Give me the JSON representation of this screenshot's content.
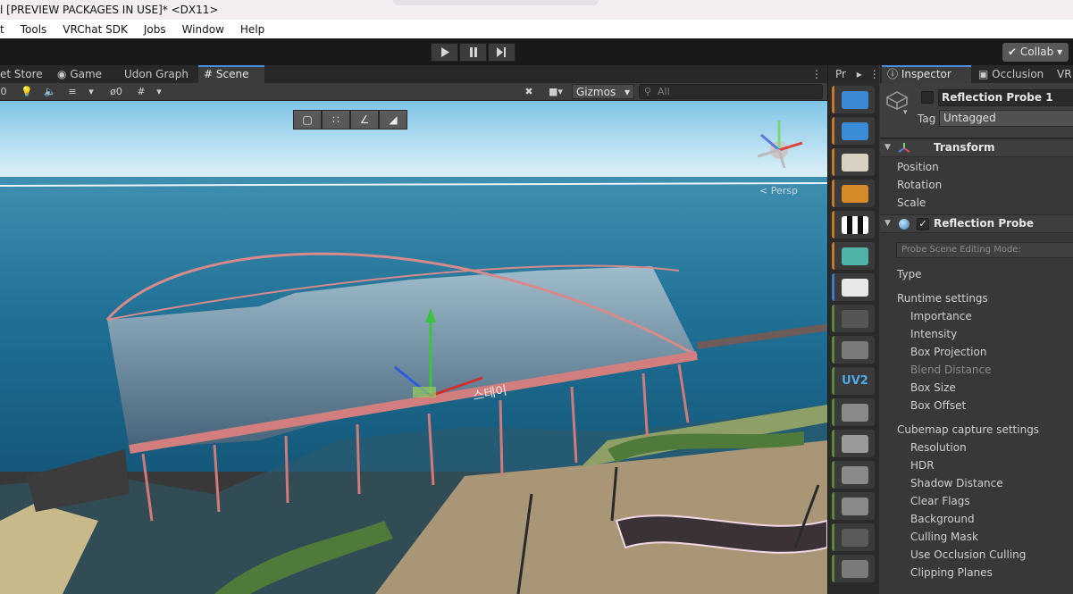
{
  "window": {
    "title": "l [PREVIEW PACKAGES IN USE]* <DX11>"
  },
  "menu": [
    "t",
    "Tools",
    "VRChat SDK",
    "Jobs",
    "Window",
    "Help"
  ],
  "toolbar": {
    "play_icon": "play-icon",
    "pause_icon": "pause-icon",
    "step_icon": "step-icon",
    "collab_label": "Collab"
  },
  "scene_tabs": [
    "et Store",
    "Game",
    "Udon Graph",
    "Scene"
  ],
  "scene_toolbar": {
    "count_label": "0",
    "hidden_count": "0",
    "gizmos_label": "Gizmos",
    "search_placeholder": "All"
  },
  "scene_view": {
    "persp_label": "< Persp",
    "sign_text": "스테이",
    "orientation_buttons": [
      "cube-view-icon",
      "pivot-view-icon",
      "vertex-snap-icon",
      "plane-view-icon"
    ]
  },
  "tool_strip": {
    "header": "Pr"
  },
  "inspector": {
    "tabs": [
      "Inspector",
      "Occlusion",
      "VR"
    ],
    "object_name": "Reflection Probe 1",
    "tag_label": "Tag",
    "tag_value": "Untagged",
    "transform": {
      "title": "Transform",
      "fields": [
        "Position",
        "Rotation",
        "Scale"
      ]
    },
    "reflection_probe": {
      "title": "Reflection Probe",
      "editing_mode_label": "Probe Scene Editing Mode:",
      "type_label": "Type",
      "runtime_header": "Runtime settings",
      "runtime_fields": [
        "Importance",
        "Intensity",
        "Box Projection",
        "Blend Distance",
        "Box Size",
        "Box Offset"
      ],
      "cubemap_header": "Cubemap capture settings",
      "cubemap_fields": [
        "Resolution",
        "HDR",
        "Shadow Distance",
        "Clear Flags",
        "Background",
        "Culling Mask",
        "Use Occlusion Culling",
        "Clipping Planes"
      ]
    }
  },
  "colors": {
    "accent": "#4b8cdc",
    "tool_orange": "#c57a2c",
    "tool_green": "#5d8a3a"
  }
}
